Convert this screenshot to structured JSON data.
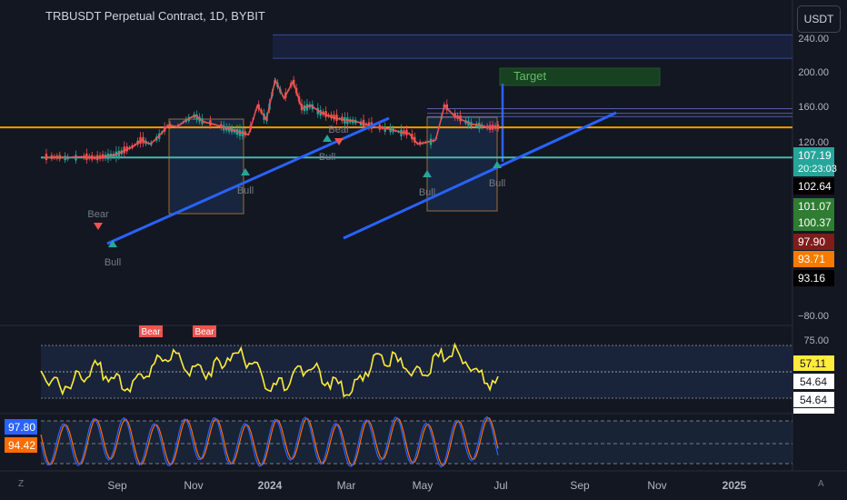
{
  "header": {
    "title": "TRBUSDT Perpetual Contract, 1D, BYBIT",
    "currency_button": "USDT"
  },
  "corner": {
    "left": "Z",
    "right": "A"
  },
  "colors": {
    "background": "#131722",
    "bull_green": "#26a69a",
    "bear_red": "#ef5350",
    "trendline_blue": "#2962ff",
    "level_orange": "#ff9800",
    "level_teal": "#4db6ac",
    "box_orange": "#ffb74d",
    "rsi_yellow": "#ffeb3b",
    "stoch_blue": "#2962ff",
    "stoch_orange": "#ff6d00"
  },
  "price_axis": {
    "ticks": [
      "240.00",
      "200.00",
      "160.00",
      "120.00",
      "80.00",
      "−80.00"
    ]
  },
  "price_tags": [
    {
      "text": "107.19",
      "sub": "20:23:03",
      "bg": "#26a69a",
      "fg": "#ffffff"
    },
    {
      "text": "102.64",
      "bg": "#000000",
      "fg": "#ffffff"
    },
    {
      "text": "101.07",
      "bg": "#2e7d32",
      "fg": "#ffffff"
    },
    {
      "text": "100.37",
      "bg": "#2e7d32",
      "fg": "#ffffff"
    },
    {
      "text": "97.90",
      "bg": "#7f1d1d",
      "fg": "#ffffff"
    },
    {
      "text": "93.71",
      "bg": "#f57c00",
      "fg": "#ffffff"
    },
    {
      "text": "93.16",
      "bg": "#000000",
      "fg": "#ffffff"
    }
  ],
  "rsi_axis": {
    "ticks": [
      "75.00"
    ],
    "tags": [
      {
        "text": "57.11",
        "bg": "#ffeb3b",
        "fg": "#131722"
      },
      {
        "text": "54.64",
        "bg": "#ffffff",
        "fg": "#131722"
      },
      {
        "text": "54.64",
        "bg": "#ffffff",
        "fg": "#131722"
      }
    ]
  },
  "stoch_tags": [
    {
      "text": "97.80",
      "bg": "#2962ff",
      "fg": "#ffffff"
    },
    {
      "text": "94.42",
      "bg": "#ff6d00",
      "fg": "#ffffff"
    }
  ],
  "time_axis": [
    "Sep",
    "Nov",
    "2024",
    "Mar",
    "May",
    "Jul",
    "Sep",
    "Nov",
    "2025"
  ],
  "annotations": {
    "target": "Target",
    "signals": [
      "Bear",
      "Bull",
      "Bull",
      "Bear",
      "Bull",
      "Bull",
      "Bull"
    ],
    "rsi_signals": [
      "Bear",
      "Bear"
    ]
  },
  "chart_data": {
    "type": "line",
    "series": [
      {
        "values": [
          62,
          62,
          62,
          62,
          63,
          62,
          61,
          64,
          66,
          72,
          78,
          88,
          82,
          95,
          110,
          108,
          118,
          125,
          115,
          112,
          108,
          104,
          100,
          96,
          140,
          118,
          178,
          150,
          176,
          135,
          140,
          130,
          124,
          120,
          118,
          116,
          112,
          108,
          106,
          104,
          100,
          98,
          82,
          85,
          88,
          140,
          125,
          118,
          112,
          110,
          106,
          107.19
        ]
      }
    ],
    "levels": [
      245,
      210,
      135,
      128,
      123,
      107,
      62
    ],
    "ylim": [
      -80,
      260
    ]
  }
}
